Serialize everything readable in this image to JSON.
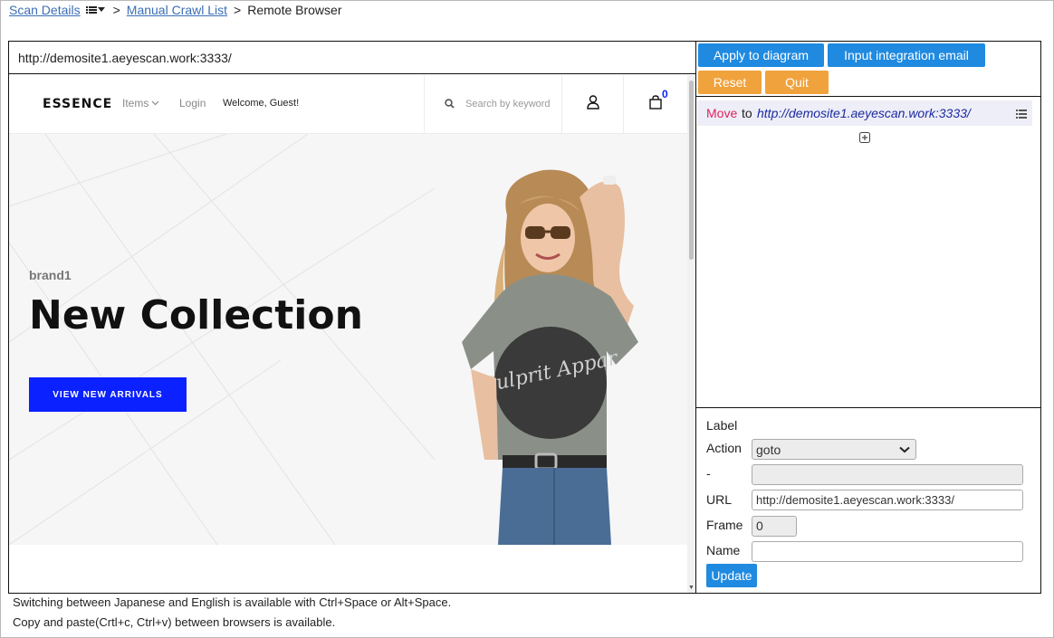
{
  "breadcrumb": {
    "scan_details": "Scan Details",
    "separator": ">",
    "manual_crawl_list": "Manual Crawl List",
    "current": "Remote Browser"
  },
  "remote": {
    "url": "http://demosite1.aeyescan.work:3333/",
    "site": {
      "logo": "ESSENCE",
      "nav_items": "Items",
      "nav_login": "Login",
      "welcome": "Welcome, Guest!",
      "search_placeholder": "Search by keyword",
      "cart_count": "0",
      "hero_brand": "brand1",
      "hero_title": "New Collection",
      "hero_button": "VIEW NEW ARRIVALS",
      "tshirt_text": "Culprit Appar"
    },
    "colors": {
      "accent": "#0b21ff"
    }
  },
  "toolbar": {
    "apply_label": "Apply to diagram",
    "integration_label": "Input integration email",
    "reset_label": "Reset",
    "quit_label": "Quit"
  },
  "steps": [
    {
      "action": "Move",
      "connector": "to",
      "target": "http://demosite1.aeyescan.work:3333/"
    }
  ],
  "form": {
    "label_label": "Label",
    "action_label": "Action",
    "action_value": "goto",
    "dash_label": "-",
    "url_label": "URL",
    "url_value": "http://demosite1.aeyescan.work:3333/",
    "frame_label": "Frame",
    "frame_value": "0",
    "name_label": "Name",
    "update_label": "Update"
  },
  "notes": {
    "line1": "Switching between Japanese and English is available with Ctrl+Space or Alt+Space.",
    "line2": "Copy and paste(Crtl+c, Ctrl+v) between browsers is available."
  },
  "colors": {
    "primary": "#1f8ae0",
    "warning": "#f0a23c",
    "action": "#e0245e"
  }
}
